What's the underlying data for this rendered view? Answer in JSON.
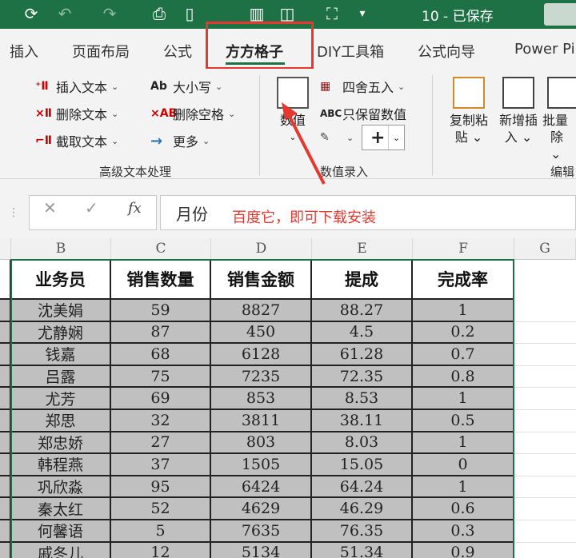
{
  "titlebar": {
    "doc_title": "10 - 已保存",
    "icons": [
      "autosave-icon",
      "undo-icon",
      "redo-icon",
      "print-preview-icon",
      "new-document-icon",
      "chart-icon",
      "shapes-icon",
      "screenshot-icon",
      "dropdown-icon"
    ]
  },
  "tabs": [
    {
      "label": "插入"
    },
    {
      "label": "页面布局"
    },
    {
      "label": "公式"
    },
    {
      "label": "方方格子"
    },
    {
      "label": "DIY工具箱"
    },
    {
      "label": "公式向导"
    },
    {
      "label": "Power Pi"
    }
  ],
  "ribbon": {
    "text_group": {
      "label": "高级文本处理",
      "buttons": [
        "插入文本",
        "删除文本",
        "截取文本",
        "大小写",
        "删除空格",
        "更多"
      ]
    },
    "number_group": {
      "label": "数值录入",
      "big_button": "数值",
      "buttons": [
        "四舍五入",
        "只保留数值"
      ],
      "plus_symbol": "+"
    },
    "edit_group": {
      "label": "编辑",
      "big_buttons": [
        {
          "line1": "复制粘",
          "line2": "贴"
        },
        {
          "line1": "新增插",
          "line2": "入"
        },
        {
          "line1": "批量",
          "line2": "除"
        }
      ]
    }
  },
  "formula_bar": {
    "value": "月份",
    "annotation": "百度它，即可下载安装",
    "fx": "fx"
  },
  "grid": {
    "columns": [
      "B",
      "C",
      "D",
      "E",
      "F",
      "G"
    ],
    "headers": [
      "业务员",
      "销售数量",
      "销售金额",
      "提成",
      "完成率"
    ],
    "rows": [
      [
        "沈美娟",
        "59",
        "8827",
        "88.27",
        "1"
      ],
      [
        "尤静娴",
        "87",
        "450",
        "4.5",
        "0.2"
      ],
      [
        "钱嘉",
        "68",
        "6128",
        "61.28",
        "0.7"
      ],
      [
        "吕露",
        "75",
        "7235",
        "72.35",
        "0.8"
      ],
      [
        "尤芳",
        "69",
        "853",
        "8.53",
        "1"
      ],
      [
        "郑思",
        "32",
        "3811",
        "38.11",
        "0.5"
      ],
      [
        "郑忠娇",
        "27",
        "803",
        "8.03",
        "1"
      ],
      [
        "韩程燕",
        "37",
        "1505",
        "15.05",
        "0"
      ],
      [
        "巩欣淼",
        "95",
        "6424",
        "64.24",
        "1"
      ],
      [
        "秦太红",
        "52",
        "4629",
        "46.29",
        "0.6"
      ],
      [
        "何馨语",
        "5",
        "7635",
        "76.35",
        "0.3"
      ],
      [
        "戚冬儿",
        "12",
        "5134",
        "51.34",
        "0.9"
      ]
    ]
  },
  "colors": {
    "excel_green": "#1e7145",
    "annotation_red": "#e5392f",
    "cell_fill": "#c0c0c0"
  }
}
